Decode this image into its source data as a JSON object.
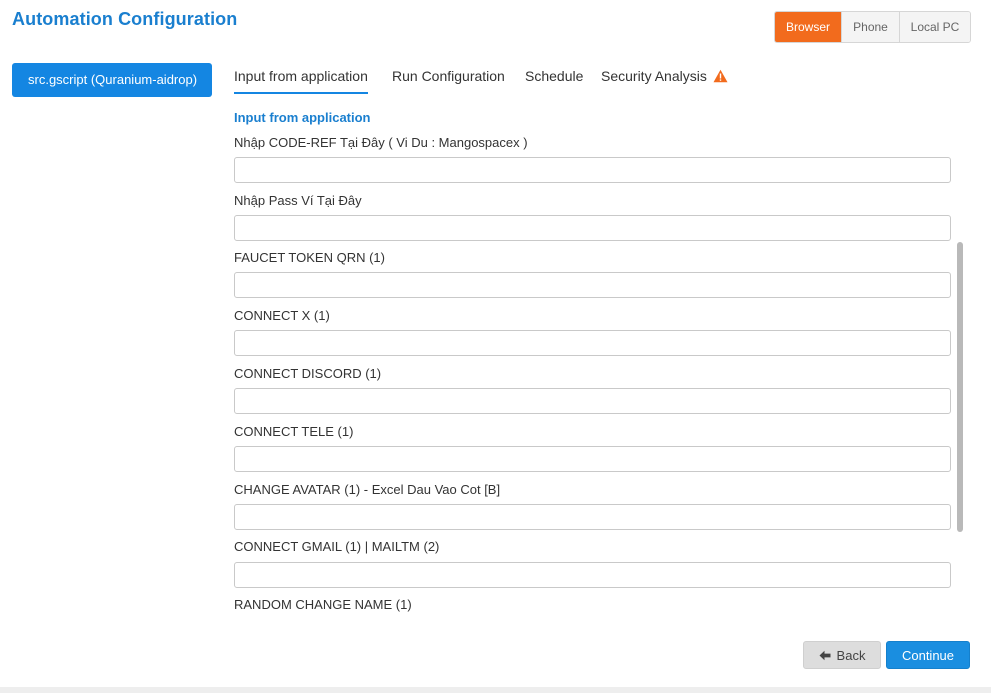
{
  "header": {
    "title": "Automation Configuration"
  },
  "modes": [
    {
      "label": "Browser",
      "active": true
    },
    {
      "label": "Phone",
      "active": false
    },
    {
      "label": "Local PC",
      "active": false
    }
  ],
  "sidebar": {
    "script_label": "src.gscript  (Quranium-aidrop)"
  },
  "tabs": [
    {
      "label": "Input from application",
      "active": true
    },
    {
      "label": "Run Configuration",
      "active": false
    },
    {
      "label": "Schedule",
      "active": false
    },
    {
      "label": "Security Analysis",
      "active": false,
      "icon": "warning-icon"
    }
  ],
  "form": {
    "section_title": "Input from application",
    "fields": [
      {
        "label": "Nhập CODE-REF Tại Đây ( Vi Du : Mangospacex )",
        "value": ""
      },
      {
        "label": "Nhập Pass Ví Tại Đây",
        "value": ""
      },
      {
        "label": "FAUCET TOKEN QRN (1)",
        "value": ""
      },
      {
        "label": "CONNECT X (1)",
        "value": ""
      },
      {
        "label": "CONNECT DISCORD (1)",
        "value": ""
      },
      {
        "label": "CONNECT TELE (1)",
        "value": ""
      },
      {
        "label": "CHANGE AVATAR (1) - Excel Dau Vao Cot [B]",
        "value": ""
      },
      {
        "label": "CONNECT GMAIL (1) | MAILTM (2)",
        "value": ""
      },
      {
        "label": "RANDOM CHANGE NAME (1)",
        "value": ""
      }
    ]
  },
  "footer": {
    "back_label": "Back",
    "continue_label": "Continue"
  },
  "colors": {
    "accent": "#1486e2",
    "brand_orange": "#f26b1d",
    "warning": "#f26b1d"
  }
}
